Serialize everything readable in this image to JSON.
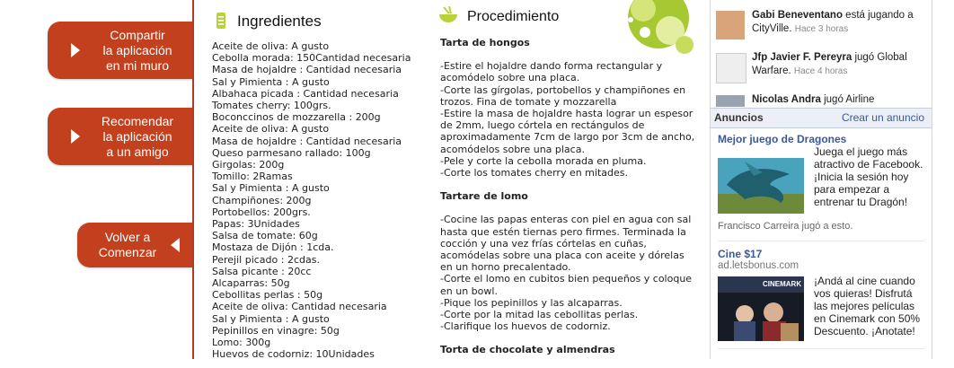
{
  "sidebar": {
    "share": [
      "Compartir",
      "la aplicación",
      "en mi muro"
    ],
    "recommend": [
      "Recomendar",
      "la aplicación",
      "a un amigo"
    ],
    "back": [
      "Volver a",
      "Comenzar"
    ]
  },
  "ingredients": {
    "title": "Ingredientes",
    "items": [
      "Aceite de oliva: A gusto",
      "Cebolla morada: 150Cantidad necesaria",
      "Masa de hojaldre : Cantidad necesaria",
      "Sal y Pimienta : A gusto",
      "Albahaca picada : Cantidad necesaria",
      "Tomates cherry: 100grs.",
      "Boconccinos de mozzarella : 200g",
      "Aceite de oliva: A gusto",
      "Masa de hojaldre : Cantidad necesaria",
      "Queso parmesano rallado: 100g",
      "Girgolas: 200g",
      "Tomillo: 2Ramas",
      "Sal y Pimienta : A gusto",
      "Champiñones: 200g",
      "Portobellos: 200grs.",
      "Papas: 3Unidades",
      "Salsa de tomate: 60g",
      "Mostaza de Dijón : 1cda.",
      "Perejil picado : 2cdas.",
      "Salsa picante : 20cc",
      "Alcaparras: 50g",
      "Cebollitas perlas : 50g",
      "Aceite de oliva: Cantidad necesaria",
      "Sal y Pimienta : A gusto",
      "Pepinillos en vinagre: 50g",
      "Lomo: 300g",
      "Huevos de codorniz: 10Unidades"
    ]
  },
  "procedure": {
    "title": "Procedimiento",
    "recipes": [
      {
        "title": "Tarta de hongos",
        "steps": [
          "-Estire el hojaldre dando forma rectangular y acomódelo sobre una placa.",
          "-Corte las gírgolas, portobellos y champiñones en trozos. Fina de tomate y mozzarella",
          "-Estire la masa de hojaldre hasta lograr un espesor de 2mm, luego córtela en rectángulos de aproximadamente 7cm de largo por 3cm de ancho, acomódelos sobre una placa.",
          "-Pele y corte la cebolla morada en pluma.",
          "-Corte los tomates cherry en mitades."
        ]
      },
      {
        "title": "Tartare de lomo",
        "steps": [
          "-Cocine las papas enteras con piel en agua con sal hasta que estén tiernas pero firmes. Terminada la cocción y una vez frías córtelas en cuñas, acomódelas sobre una placa con aceite y dórelas en un horno precalentado.",
          "-Corte el lomo en cubitos bien pequeños y coloque en un bowl.",
          "-Pique los pepinillos y las alcaparras.",
          "-Corte por la mitad las cebollitas perlas.",
          "-Clarifique los huevos de codorniz."
        ]
      },
      {
        "title": "Torta de chocolate y almendras",
        "steps": []
      }
    ]
  },
  "facebook": {
    "stories": [
      {
        "name": "Gabi Beneventano",
        "action": "está jugando a CityVille.",
        "time": "Hace 3 horas"
      },
      {
        "name": "Jfp Javier F. Pereyra",
        "action": "jugó Global Warfare.",
        "time": "Hace 4 horas"
      },
      {
        "name": "Nicolas Andra",
        "action": "jugó Airline",
        "time": ""
      }
    ],
    "ads_title": "Anuncios",
    "create_ad": "Crear un anuncio",
    "ads": [
      {
        "title": "Mejor juego de Dragones",
        "url": "",
        "desc": "Juega el juego más atractivo de Facebook. ¡Inicia la sesión hoy para empezar a entrenar tu Dragón!",
        "footer": "Francisco Carreira jugó a esto."
      },
      {
        "title": "Cine $17",
        "url": "ad.letsbonus.com",
        "desc": "¡Andá al cine cuando vos quieras! Disfrutá las mejores películas en Cinemark con 50% Descuento. ¡Anotate!",
        "footer": "",
        "img_brand": "CINEMARK"
      }
    ]
  },
  "colors": {
    "accent": "#c2401d",
    "fb_blue": "#3b5998",
    "lime": "#a6c832"
  }
}
